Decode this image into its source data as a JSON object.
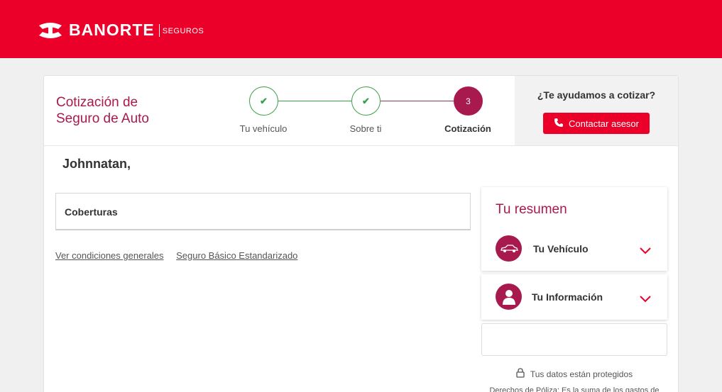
{
  "brand": {
    "name": "BANORTE",
    "sub": "SEGUROS",
    "color": "#eb0029",
    "accent": "#a8194e"
  },
  "quote": {
    "title_line1": "Cotización de",
    "title_line2": "Seguro de Auto"
  },
  "steps": [
    {
      "label": "Tu vehículo",
      "state": "done",
      "icon": "check-icon"
    },
    {
      "label": "Sobre ti",
      "state": "done",
      "icon": "check-icon"
    },
    {
      "label": "Cotización",
      "state": "active",
      "number": "3"
    }
  ],
  "help": {
    "question": "¿Te ayudamos a cotizar?",
    "button_label": "Contactar asesor",
    "icon": "phone-icon"
  },
  "user": {
    "greeting": "Johnnatan,"
  },
  "coberturas": {
    "label": "Coberturas"
  },
  "links": [
    {
      "label": "Ver condiciones generales"
    },
    {
      "label": "Seguro Básico Estandarizado"
    }
  ],
  "resumen": {
    "title": "Tu resumen",
    "items": [
      {
        "label": "Tu Vehículo",
        "icon": "car-icon"
      },
      {
        "label": "Tu Información",
        "icon": "person-icon"
      }
    ]
  },
  "footer": {
    "secure_text": "Tus datos están protegidos",
    "derechos_text": "Derechos de Póliza: Es la suma de los gastos de"
  }
}
